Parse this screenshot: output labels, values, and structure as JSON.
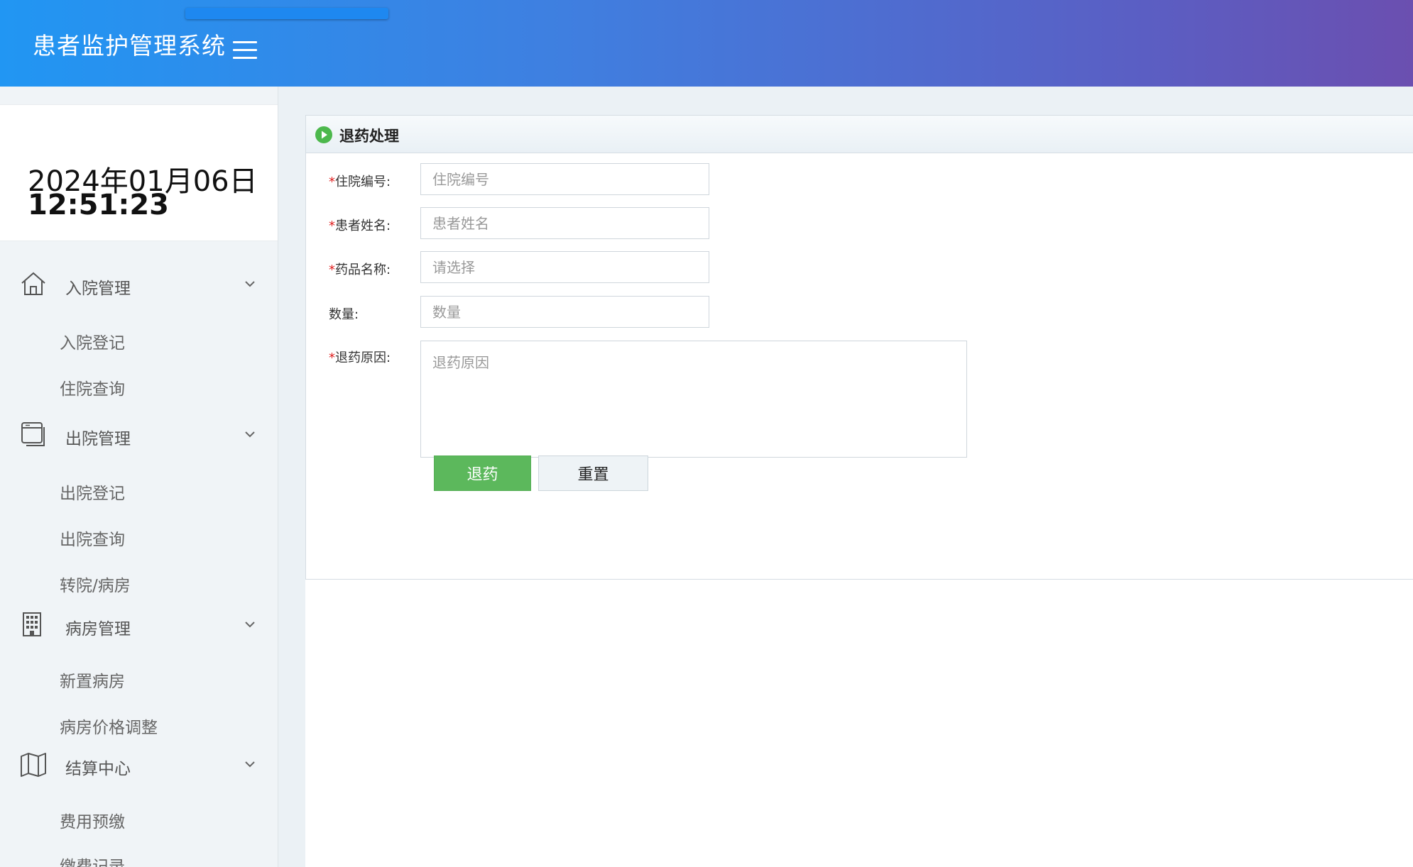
{
  "header": {
    "app_title": "患者监护管理系统",
    "menu_icon": "hamburger-icon",
    "gradient_colors": [
      "#2196f3",
      "#6b4fb0"
    ]
  },
  "sidebar": {
    "clock": {
      "date": "2024年01月06日",
      "time": "12:51:23"
    },
    "groups": [
      {
        "label": "入院管理",
        "icon": "home-icon",
        "items": [
          "入院登记",
          "住院查询"
        ]
      },
      {
        "label": "出院管理",
        "icon": "window-icon",
        "items": [
          "出院登记",
          "出院查询",
          "转院/病房"
        ]
      },
      {
        "label": "病房管理",
        "icon": "building-icon",
        "items": [
          "新置病房",
          "病房价格调整"
        ]
      },
      {
        "label": "结算中心",
        "icon": "map-icon",
        "items": [
          "费用预缴",
          "缴费记录"
        ]
      }
    ]
  },
  "main": {
    "panel_title": "退药处理",
    "form": {
      "fields": [
        {
          "label": "住院编号:",
          "required": true,
          "placeholder": "住院编号",
          "value": ""
        },
        {
          "label": "患者姓名:",
          "required": true,
          "placeholder": "患者姓名",
          "value": ""
        },
        {
          "label": "药品名称:",
          "required": true,
          "placeholder": "请选择",
          "value": ""
        },
        {
          "label": "数量:",
          "required": false,
          "placeholder": "数量",
          "value": ""
        },
        {
          "label": "退药原因:",
          "required": true,
          "placeholder": "退药原因",
          "value": ""
        }
      ],
      "required_mark": "*",
      "submit_label": "退药",
      "reset_label": "重置"
    },
    "colors": {
      "submit": "#5cb85c",
      "required": "#e02020"
    }
  }
}
